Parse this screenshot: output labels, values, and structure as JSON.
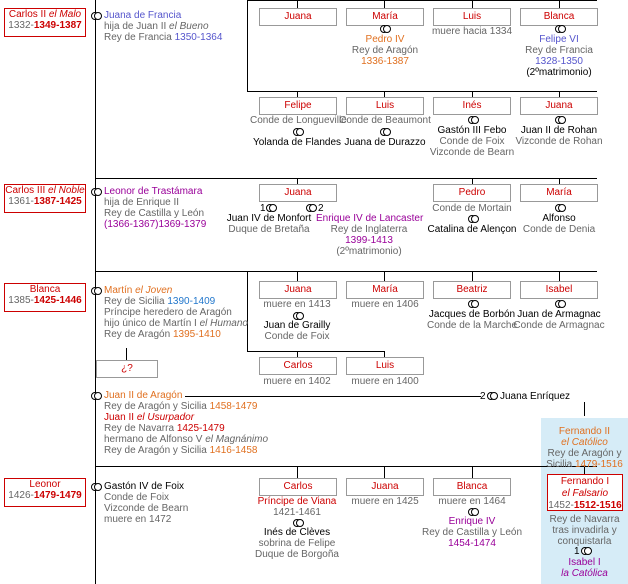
{
  "row1": {
    "ancestor": {
      "name": "Carlos II",
      "epithet": "el Malo",
      "dates_plain": "1332-",
      "dates_reign": "1349-1387"
    },
    "spouse": {
      "name": "Juana de Francia",
      "desc1_a": "hija de Juan II",
      "desc1_b": "el Bueno",
      "desc2_a": "Rey de Francia",
      "desc2_b": "1350-1364"
    },
    "children_a": [
      {
        "name": "Juana"
      },
      {
        "name": "María",
        "spouse_name": "Pedro IV",
        "spouse_title": "Rey de Aragón",
        "spouse_dates": "1336-1387"
      },
      {
        "name": "Luis",
        "note": "muere hacia 1334"
      },
      {
        "name": "Blanca",
        "spouse_name": "Felipe VI",
        "spouse_title": "Rey de Francia",
        "spouse_dates": "1328-1350",
        "spouse_note": "(2ºmatrimonio)"
      }
    ],
    "children_b": [
      {
        "name": "Felipe",
        "title": "Conde de Longueville",
        "spouse_name": "Yolanda de Flandes"
      },
      {
        "name": "Luis",
        "title": "Conde de Beaumont",
        "spouse_name": "Juana de Durazzo"
      },
      {
        "name": "Inés",
        "spouse_name": "Gastón III Febo",
        "spouse_t1": "Conde de Foix",
        "spouse_t2": "Vizconde de Bearn"
      },
      {
        "name": "Juana",
        "spouse_name": "Juan II de Rohan",
        "spouse_t1": "Vizconde de Rohan"
      }
    ]
  },
  "row2": {
    "ancestor": {
      "name": "Carlos III",
      "epithet": "el Noble",
      "dates_plain": "1361-",
      "dates_reign": "1387-1425"
    },
    "spouse": {
      "name": "Leonor de Trastámara",
      "d1": "hija de Enrique II",
      "d2": "Rey de Castilla y León",
      "d3_a": "(1366-1367)",
      "d3_b": "1369-1379"
    },
    "juana": {
      "name": "Juana",
      "num1": "1",
      "num2": "2",
      "husband1": "Juan IV de Monfort",
      "h1_title": "Duque de Bretaña",
      "husband2": "Enrique IV de Lancaster",
      "h2_title": "Rey de Inglaterra",
      "h2_dates": "1399-1413",
      "h2_note": "(2ºmatrimonio)"
    },
    "pedro": {
      "name": "Pedro",
      "t1": "Conde de Mortain",
      "spouse_name": "Catalina de Alençon"
    },
    "maria": {
      "name": "María",
      "spouse_name": "Alfonso",
      "spouse_title": "Conde de Denia"
    }
  },
  "row3": {
    "ancestor": {
      "name": "Blanca",
      "dates_plain": "1385-",
      "dates_reign": "1425-1446"
    },
    "spouse": {
      "name": "Martín",
      "epithet": "el Joven",
      "d1_a": "Rey de Sicilia",
      "d1_b": "1390-1409",
      "d2": "Príncipe heredero de Aragón",
      "d3_a": "hijo único de Martín I",
      "d3_b": "el Humano",
      "d4_a": "Rey de Aragón",
      "d4_b": "1395-1410"
    },
    "unknown": "¿?",
    "children": [
      {
        "name": "Juana",
        "note": "muere en 1413",
        "spouse_name": "Juan de Grailly",
        "spouse_title": "Conde de Foix"
      },
      {
        "name": "María",
        "note": "muere en 1406"
      },
      {
        "name": "Beatriz",
        "spouse_name": "Jacques de Borbón",
        "spouse_title": "Conde de la Marche"
      },
      {
        "name": "Isabel",
        "spouse_name": "Juan de Armagnac",
        "spouse_title": "Conde de Armagnac"
      },
      {
        "name": "Carlos",
        "note": "muere en 1402"
      },
      {
        "name": "Luis",
        "note": "muere en 1400"
      }
    ]
  },
  "row4": {
    "spouse": {
      "name": "Juan II de Aragón",
      "d1_a": "Rey de Aragón y Sicilia",
      "d1_b": "1458-1479",
      "d2_a": "Juan II",
      "d2_b": "el Usurpador",
      "d3_a": "Rey de Navarra",
      "d3_b": "1425-1479",
      "d4_a": "hermano de Alfonso V",
      "d4_b": "el Magnánimo",
      "d5_a": "Rey de Aragón y Sicilia",
      "d5_b": "1416-1458"
    },
    "second": {
      "num": "2",
      "name": "Juana Enríquez"
    },
    "fernando2": {
      "name": "Fernando II",
      "epithet": "el Católico",
      "t1": "Rey de Aragón y",
      "t2_a": "Sicilia",
      "t2_b": "1479-1516"
    },
    "fernando1": {
      "name": "Fernando I",
      "epithet": "el Falsario",
      "dates_plain": "1452-",
      "dates_reign": "1512-1516",
      "t1": "Rey de Navarra",
      "t2": "tras invadirla y",
      "t3": "conquistarla"
    },
    "isabel": {
      "num": "1",
      "name": "Isabel I",
      "epithet": "la Católica"
    }
  },
  "row5": {
    "ancestor": {
      "name": "Leonor",
      "dates_plain": "1426-",
      "dates_reign": "1479-1479"
    },
    "spouse": {
      "name": "Gastón IV de Foix",
      "t1": "Conde de Foix",
      "t2": "Vizconde de Bearn",
      "t3": "muere en 1472"
    },
    "children": [
      {
        "name": "Carlos",
        "title": "Príncipe de Viana",
        "dates": "1421-1461",
        "spouse_name": "Inés de Clèves",
        "spouse_t1": "sobrina de Felipe",
        "spouse_t2": "Duque de Borgoña"
      },
      {
        "name": "Juana",
        "note": "muere en 1425"
      },
      {
        "name": "Blanca",
        "note": "muere en 1464",
        "spouse_name": "Enrique IV",
        "spouse_title": "Rey de Castilla y León",
        "spouse_dates": "1454-1474"
      }
    ]
  }
}
